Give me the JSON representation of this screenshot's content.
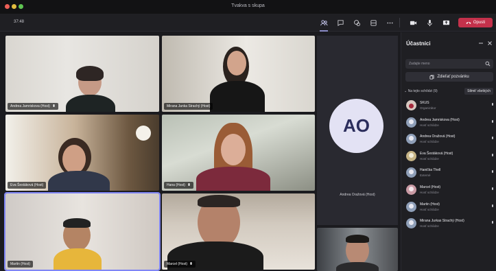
{
  "window": {
    "title": "Tvakva s skupa"
  },
  "toolbar": {
    "timer": "37:48",
    "leave_label": "Opusti"
  },
  "video_tiles": [
    {
      "name": "Andrea Jamriskova (Host)"
    },
    {
      "name": "Mirana Janka Strachý (Host)"
    },
    {
      "name": "Eva Šestáková (Host)"
    },
    {
      "name": "Hana (Host)"
    },
    {
      "name": "Martin (Host)"
    },
    {
      "name": "Marcel (Host)"
    }
  ],
  "spotlight": {
    "initials": "AO",
    "name": "Andrea Oražová (Host)"
  },
  "panel": {
    "title": "Účastníci",
    "invite_placeholder": "Zadajte meno",
    "share_label": "Zdieľať pozvánku",
    "section_label": "Na tejto schôdzi (9)",
    "mute_all_label": "Stlmiť všetkých",
    "participants": [
      {
        "name": "SKUS",
        "role": "Organizátor"
      },
      {
        "name": "Andrea Jamriskova (Host)",
        "role": "Hosť schôdze"
      },
      {
        "name": "Andrea Oražová (Host)",
        "role": "Hosť schôdze"
      },
      {
        "name": "Eva Šestáková (Host)",
        "role": "Hosť schôdze"
      },
      {
        "name": "Hanička Thell",
        "role": "Externé"
      },
      {
        "name": "Marcel (Host)",
        "role": "Hosť schôdze"
      },
      {
        "name": "Martin (Host)",
        "role": "Hosť schôdze"
      },
      {
        "name": "Mirana Jurkas Strachý (Host)",
        "role": "Hosť schôdze"
      }
    ]
  },
  "colors": {
    "accent": "#7f85f5",
    "leave": "#c4314b",
    "avatar_bg": "#e3e2f4"
  }
}
